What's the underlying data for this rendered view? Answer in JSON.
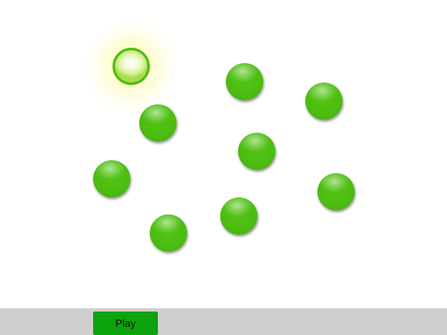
{
  "game": {
    "colors": {
      "dot": "#4cbd10",
      "dot_lit_center": "#ffffff",
      "glow": "#fdf8aa",
      "controls_bar": "#cfcfcf",
      "play_button": "#0da30d"
    },
    "dots": [
      {
        "id": 1,
        "lit": true
      },
      {
        "id": 2,
        "lit": false
      },
      {
        "id": 3,
        "lit": false
      },
      {
        "id": 4,
        "lit": false
      },
      {
        "id": 5,
        "lit": false
      },
      {
        "id": 6,
        "lit": false
      },
      {
        "id": 7,
        "lit": false
      },
      {
        "id": 8,
        "lit": false
      },
      {
        "id": 9,
        "lit": false
      },
      {
        "id": 10,
        "lit": false
      }
    ]
  },
  "controls": {
    "play_label": "Play"
  }
}
